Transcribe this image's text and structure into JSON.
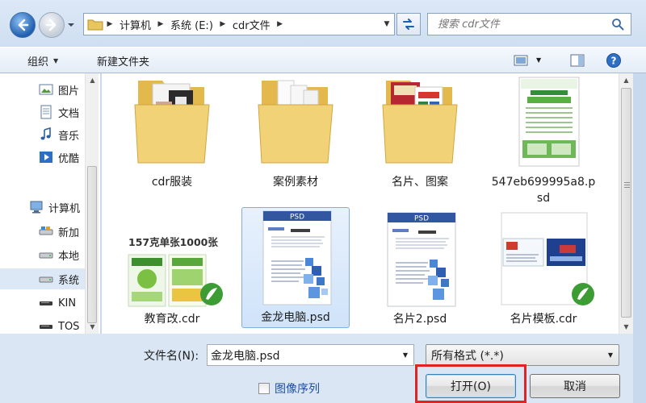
{
  "address": {
    "crumbs": [
      "计算机",
      "系统 (E:)",
      "cdr文件"
    ]
  },
  "search": {
    "placeholder": "搜索 cdr文件"
  },
  "toolbar": {
    "organize": "组织",
    "new_folder": "新建文件夹"
  },
  "nav": {
    "items": [
      {
        "label": "图片",
        "icon": "pictures-icon"
      },
      {
        "label": "文档",
        "icon": "documents-icon"
      },
      {
        "label": "音乐",
        "icon": "music-icon"
      },
      {
        "label": "优酷",
        "icon": "youku-icon"
      },
      {
        "label": "计算机",
        "icon": "computer-icon"
      },
      {
        "label": "新加",
        "icon": "drive-icon"
      },
      {
        "label": "本地",
        "icon": "drive-icon"
      },
      {
        "label": "系统",
        "icon": "drive-icon",
        "selected": true
      },
      {
        "label": "KIN",
        "icon": "usb-drive-icon"
      },
      {
        "label": "TOS",
        "icon": "usb-drive-icon"
      }
    ]
  },
  "files": [
    {
      "name": "cdr服装",
      "type": "folder"
    },
    {
      "name": "案例素材",
      "type": "folder"
    },
    {
      "name": "名片、图案",
      "type": "folder"
    },
    {
      "name": "547eb699995a8.psd",
      "type": "psd"
    },
    {
      "name": "教育改.cdr",
      "type": "cdr",
      "thumb_text": "157克单张1000张"
    },
    {
      "name": "金龙电脑.psd",
      "type": "psd",
      "selected": true,
      "thumb_text": "PSD"
    },
    {
      "name": "名片2.psd",
      "type": "psd",
      "thumb_text": "PSD"
    },
    {
      "name": "名片模板.cdr",
      "type": "cdr"
    }
  ],
  "bottom": {
    "filename_label": "文件名(N):",
    "filename_value": "金龙电脑.psd",
    "filetype_value": "所有格式 (*.*)",
    "checkbox_label": "图像序列",
    "open_label": "打开(O)",
    "cancel_label": "取消"
  },
  "colors": {
    "highlight": "#e02424",
    "selection": "#cfe3fa",
    "chrome": "#dae6f4"
  }
}
